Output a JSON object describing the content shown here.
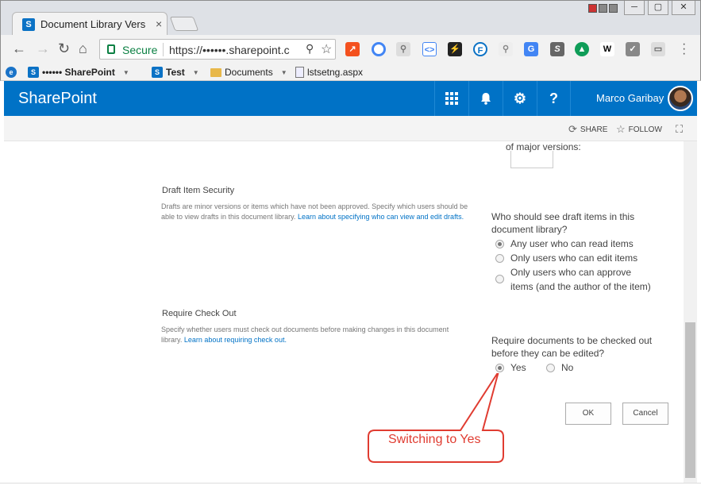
{
  "browser": {
    "tab_title": "Document Library Versio",
    "tab_close": "×",
    "omnibox": {
      "secure_label": "Secure",
      "url": "https://••••••.sharepoint.c"
    },
    "bookmarks": [
      {
        "label": "•••••• SharePoint",
        "icon": "sharepoint-icon"
      },
      {
        "label": "Test",
        "icon": "sharepoint-icon"
      },
      {
        "label": "Documents",
        "icon": "folder-icon"
      },
      {
        "label": "lstsetng.aspx",
        "icon": "page-icon"
      }
    ]
  },
  "suitebar": {
    "brand": "SharePoint",
    "user_name": "Marco Garibay",
    "buttons": [
      "app-launcher-icon",
      "bell-icon",
      "gear-icon",
      "help-icon"
    ],
    "help_glyph": "?"
  },
  "actions": {
    "share": "SHARE",
    "follow": "FOLLOW"
  },
  "page": {
    "prev_fragment": "of major versions:",
    "draft_security": {
      "title": "Draft Item Security",
      "description": "Drafts are minor versions or items which have not been approved. Specify which users should be able to view drafts in this document library.",
      "link": "Learn about specifying who can view and edit drafts.",
      "question": "Who should see draft items in this document library?",
      "options": [
        {
          "label": "Any user who can read items",
          "selected": true
        },
        {
          "label": "Only users who can edit items",
          "selected": false
        },
        {
          "label": "Only users who can approve items (and the author of the item)",
          "selected": false
        }
      ]
    },
    "check_out": {
      "title": "Require Check Out",
      "description": "Specify whether users must check out documents before making changes in this document library.",
      "link": "Learn about requiring check out.",
      "question": "Require documents to be checked out before they can be edited?",
      "options": [
        {
          "label": "Yes",
          "selected": true
        },
        {
          "label": "No",
          "selected": false
        }
      ]
    },
    "ok_label": "OK",
    "cancel_label": "Cancel"
  },
  "annotation": {
    "text": "Switching to Yes",
    "color": "#e03c31"
  }
}
